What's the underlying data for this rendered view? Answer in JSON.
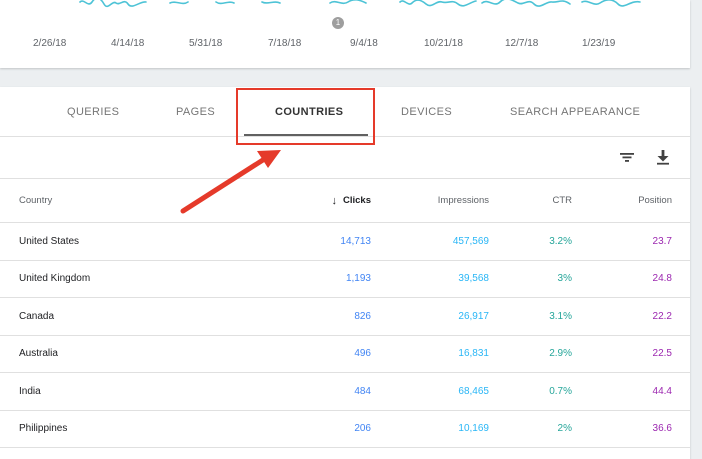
{
  "chart": {
    "annotation_count": "1",
    "x_axis_dates": [
      "2/26/18",
      "4/14/18",
      "5/31/18",
      "7/18/18",
      "9/4/18",
      "10/21/18",
      "12/7/18",
      "1/23/19"
    ],
    "line_color": "#4dc3d6"
  },
  "tabs": [
    {
      "label": "QUERIES",
      "active": false
    },
    {
      "label": "PAGES",
      "active": false
    },
    {
      "label": "COUNTRIES",
      "active": true
    },
    {
      "label": "DEVICES",
      "active": false
    },
    {
      "label": "SEARCH APPEARANCE",
      "active": false
    }
  ],
  "toolbar": {
    "filter_icon": "filter-icon",
    "download_icon": "download-icon"
  },
  "table": {
    "headers": {
      "country": "Country",
      "clicks": "Clicks",
      "impressions": "Impressions",
      "ctr": "CTR",
      "position": "Position"
    },
    "sort_indicator": "↓",
    "rows": [
      {
        "country": "United States",
        "clicks": "14,713",
        "impressions": "457,569",
        "ctr": "3.2%",
        "position": "23.7"
      },
      {
        "country": "United Kingdom",
        "clicks": "1,193",
        "impressions": "39,568",
        "ctr": "3%",
        "position": "24.8"
      },
      {
        "country": "Canada",
        "clicks": "826",
        "impressions": "26,917",
        "ctr": "3.1%",
        "position": "22.2"
      },
      {
        "country": "Australia",
        "clicks": "496",
        "impressions": "16,831",
        "ctr": "2.9%",
        "position": "22.5"
      },
      {
        "country": "India",
        "clicks": "484",
        "impressions": "68,465",
        "ctr": "0.7%",
        "position": "44.4"
      },
      {
        "country": "Philippines",
        "clicks": "206",
        "impressions": "10,169",
        "ctr": "2%",
        "position": "36.6"
      }
    ]
  },
  "colors": {
    "clicks": "#4285f4",
    "impressions": "#29b6f6",
    "ctr": "#26a69a",
    "position": "#9c27b0",
    "highlight": "#e53a2a"
  }
}
